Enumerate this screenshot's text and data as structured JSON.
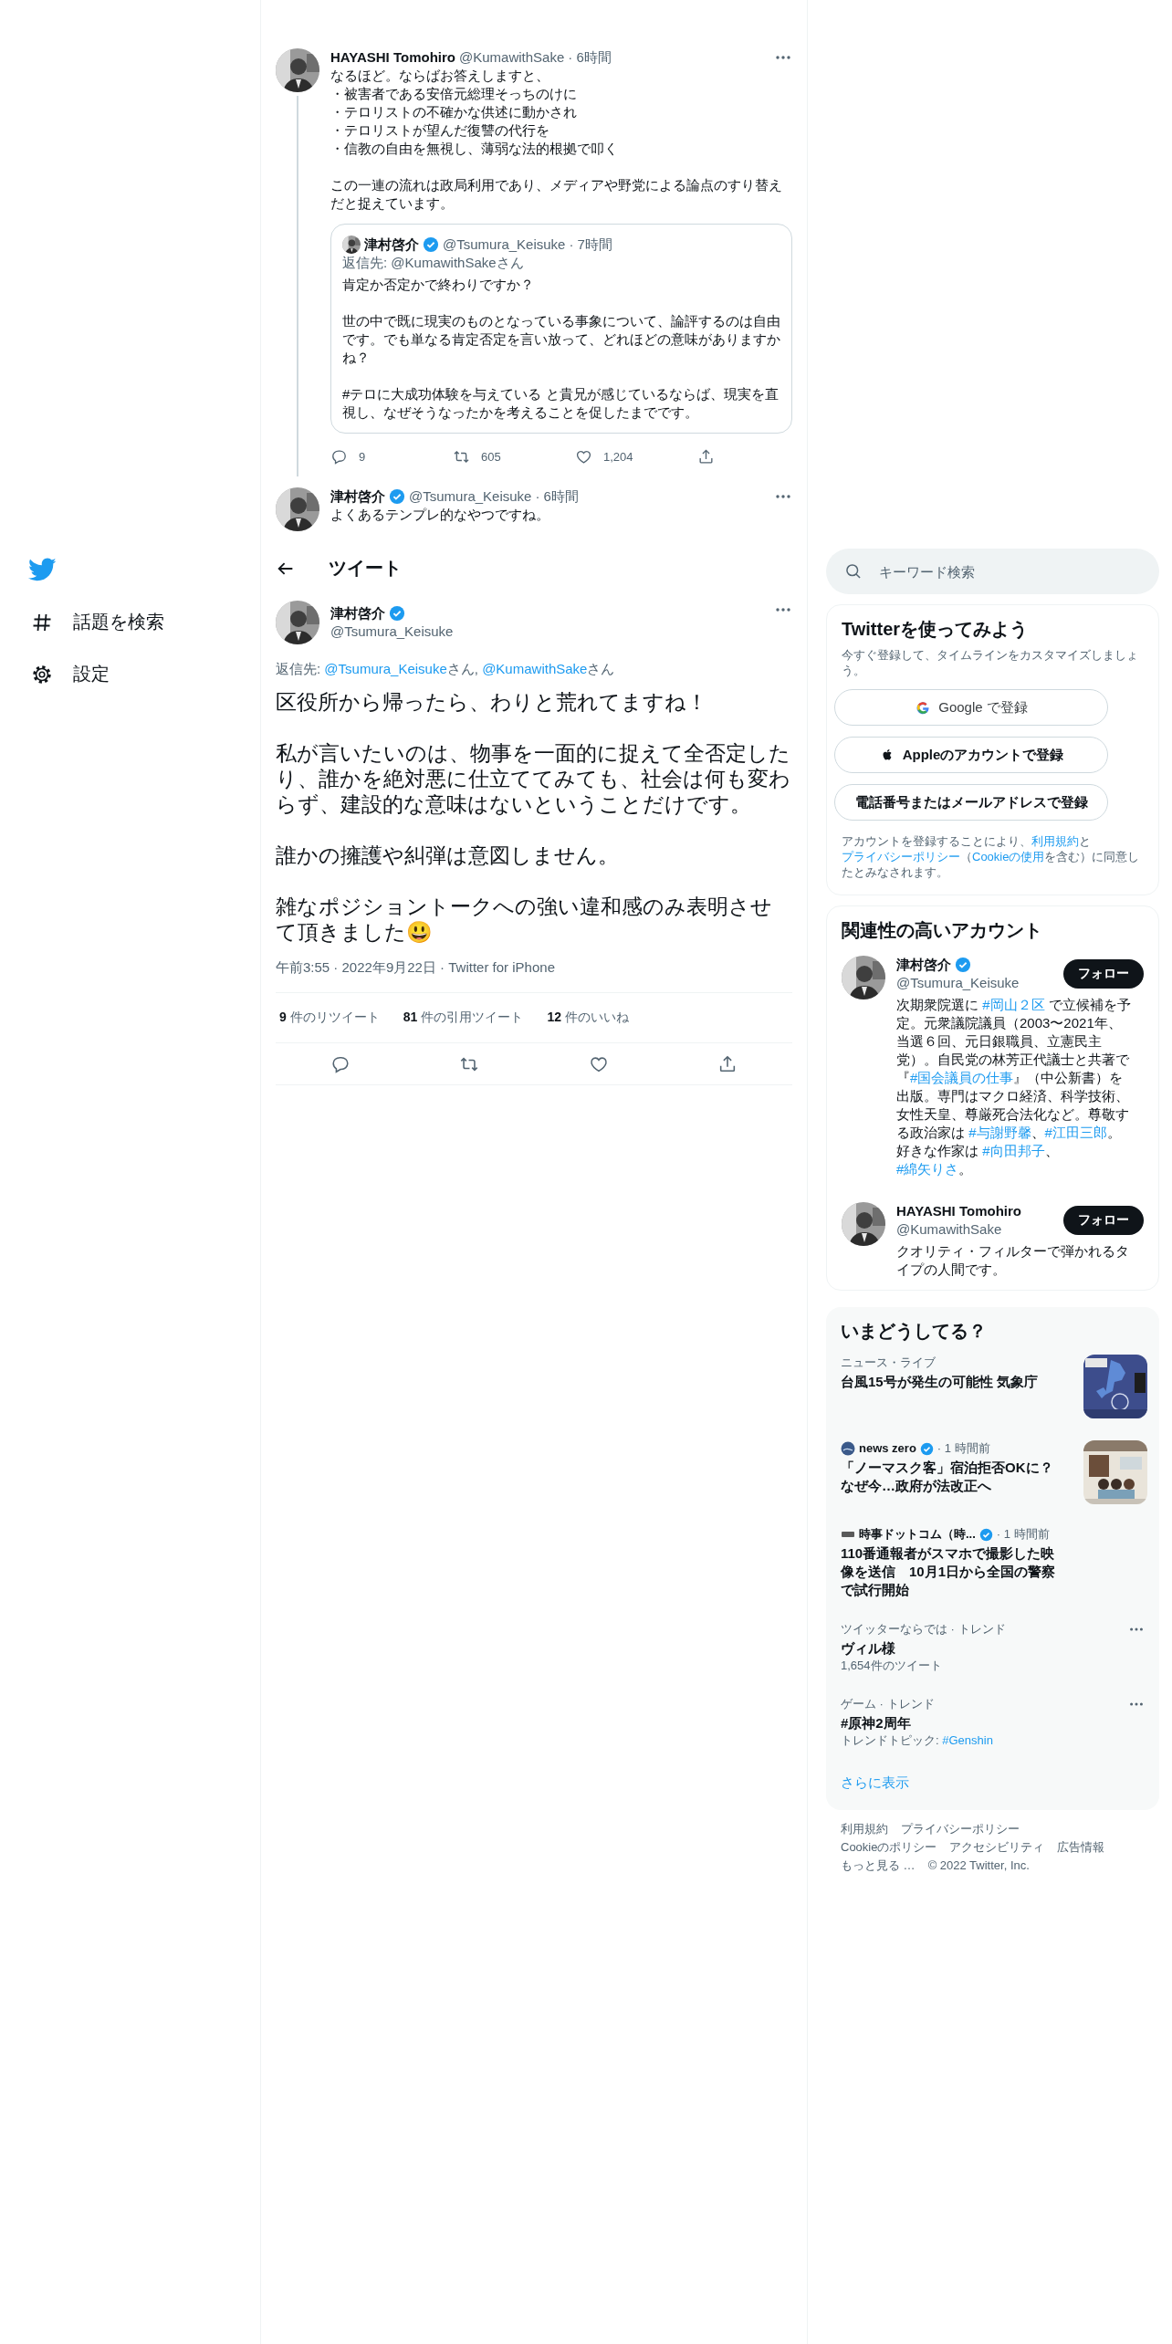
{
  "nav": {
    "items": [
      {
        "kind": "hashtag",
        "label": "話題を検索"
      },
      {
        "kind": "gear",
        "label": "設定"
      }
    ]
  },
  "thread": [
    {
      "name": "HAYASHI Tomohiro",
      "verified": false,
      "handle": "@KumawithSake",
      "time": "· 6時間",
      "text": [
        [
          "なるほど。ならばお答えしますと、",
          "・被害者である安倍元総理そっちのけに",
          "・テロリストの不確かな供述に動かされ",
          "・テロリストが望んだ復讐の代行を",
          "・信教の自由を無視し、薄弱な法的根拠で叩く"
        ],
        [
          "この一連の流れは政局利用であり、メディアや野党による論点のすり替えだと捉えています。"
        ]
      ],
      "quote": {
        "name": "津村啓介",
        "verified": true,
        "handle": "@Tsumura_Keisuke",
        "time": "· 7時間",
        "reply": [
          {
            "text": "返信先: @KumawithSakeさん",
            "link": false
          }
        ],
        "text": [
          [
            "肯定か否定かで終わりですか？"
          ],
          [
            "世の中で既に現実のものとなっている事象について、論評するのは自由です。でも単なる肯定否定を言い放って、どれほどの意味がありますかね？"
          ],
          [
            "#テロに大成功体験を与えている と貴兄が感じているならば、現実を直視し、なぜそうなったかを考えることを促したまでです。"
          ]
        ]
      },
      "actions": [
        {
          "kind": "reply",
          "count": "9"
        },
        {
          "kind": "retweet",
          "count": "605"
        },
        {
          "kind": "like",
          "count": "1,204"
        },
        {
          "kind": "share"
        }
      ]
    },
    {
      "name": "津村啓介",
      "verified": true,
      "handle": "@Tsumura_Keisuke",
      "time": "· 6時間",
      "text": [
        [
          "よくあるテンプレ的なやつですね。"
        ]
      ]
    }
  ],
  "header": {
    "title": "ツイート"
  },
  "main_tweet": {
    "name": "津村啓介",
    "verified": true,
    "handle": "@Tsumura_Keisuke",
    "reply": [
      {
        "text": "返信先: ",
        "link": false
      },
      {
        "text": "@Tsumura_Keisuke",
        "link": true
      },
      {
        "text": "さん, ",
        "link": false
      },
      {
        "text": "@KumawithSake",
        "link": true
      },
      {
        "text": "さん",
        "link": false
      }
    ],
    "text": [
      [
        "区役所から帰ったら、わりと荒れてますね！"
      ],
      [
        "私が言いたいのは、物事を一面的に捉えて全否定したり、誰かを絶対悪に仕立ててみても、社会は何も変わらず、建設的な意味はないということだけです。"
      ],
      [
        "誰かの擁護や糾弾は意図しません。"
      ],
      [
        "雑なポジショントークへの強い違和感のみ表明させて頂きました😃"
      ]
    ],
    "meta": "午前3:55 · 2022年9月22日 · Twitter for iPhone",
    "stats": [
      {
        "count": "9",
        "label": "件のリツイート"
      },
      {
        "count": "81",
        "label": "件の引用ツイート"
      },
      {
        "count": "12",
        "label": "件のいいね"
      }
    ]
  },
  "sidebar": {
    "search": {
      "placeholder": "キーワード検索"
    },
    "signup": {
      "title": "Twitterを使ってみよう",
      "subtitle": "今すぐ登録して、タイムラインをカスタマイズしましょう。",
      "buttons": [
        {
          "kind": "google",
          "label": "Google で登録"
        },
        {
          "kind": "apple",
          "label": "Appleのアカウントで登録"
        },
        {
          "kind": "plain",
          "label": "電話番号またはメールアドレスで登録"
        }
      ],
      "legal": [
        {
          "text": "アカウントを登録することにより、",
          "link": false
        },
        {
          "text": "利用規約",
          "link": true
        },
        {
          "text": "と",
          "link": false
        },
        {
          "text": "プライバシーポリシー",
          "link": true
        },
        {
          "text": "（",
          "link": false
        },
        {
          "text": "Cookieの使用",
          "link": true
        },
        {
          "text": "を含む）に同意したとみなされます。",
          "link": false
        }
      ]
    },
    "related": {
      "title": "関連性の高いアカウント",
      "accounts": [
        {
          "name": "津村啓介",
          "verified": true,
          "handle": "@Tsumura_Keisuke",
          "follow": "フォロー",
          "bio": [
            {
              "text": "次期衆院選に ",
              "link": false
            },
            {
              "text": "#岡山２区",
              "link": true
            },
            {
              "text": " で立候補を予定。元衆議院議員（2003〜2021年、当選６回、元日銀職員、立憲民主党）。自民党の林芳正代議士と共著で『",
              "link": false
            },
            {
              "text": "#国会議員の仕事",
              "link": true
            },
            {
              "text": "』（中公新書）を出版。専門はマクロ経済、科学技術、女性天皇、尊厳死合法化など。尊敬する政治家は ",
              "link": false
            },
            {
              "text": "#与謝野馨",
              "link": true
            },
            {
              "text": "、",
              "link": false
            },
            {
              "text": "#江田三郎",
              "link": true
            },
            {
              "text": "。好きな作家は ",
              "link": false
            },
            {
              "text": "#向田邦子",
              "link": true
            },
            {
              "text": "、",
              "link": false
            },
            {
              "text": "#綿矢りさ",
              "link": true
            },
            {
              "text": "。",
              "link": false
            }
          ]
        },
        {
          "name": "HAYASHI Tomohiro",
          "verified": false,
          "handle": "@KumawithSake",
          "follow": "フォロー",
          "bio": [
            {
              "text": "クオリティ・フィルターで弾かれるタイプの人間です。",
              "link": false
            }
          ]
        }
      ]
    },
    "trends": {
      "title": "いまどうしてる？",
      "items": [
        {
          "kind": "news",
          "context": "ニュース・ライブ",
          "title": "台風15号が発生の可能性 気象庁",
          "image": true
        },
        {
          "kind": "source",
          "source": "news zero",
          "verified": true,
          "time": "· 1 時間前",
          "title": "「ノーマスク客」宿泊拒否OKに？なぜ今…政府が法改正へ",
          "image": true
        },
        {
          "kind": "source",
          "source": "時事ドットコム（時...",
          "verified": true,
          "time": "· 1 時間前",
          "title": "110番通報者がスマホで撮影した映像を送信　10月1日から全国の警察で試行開始",
          "image": false
        },
        {
          "kind": "trend",
          "context": "ツイッターならでは · トレンド",
          "title": "ヴィル様",
          "meta": [
            {
              "text": "1,654件のツイート",
              "link": false
            }
          ],
          "image": false
        },
        {
          "kind": "trend",
          "context": "ゲーム · トレンド",
          "title": "#原神2周年",
          "meta": [
            {
              "text": "トレンドトピック: ",
              "link": false
            },
            {
              "text": "#Genshin",
              "link": true
            }
          ],
          "image": false
        }
      ],
      "more": "さらに表示"
    },
    "footer": {
      "links": [
        "利用規約",
        "プライバシーポリシー",
        "Cookieのポリシー",
        "アクセシビリティ",
        "広告情報",
        "もっと見る …"
      ],
      "copyright": "© 2022 Twitter, Inc."
    }
  }
}
